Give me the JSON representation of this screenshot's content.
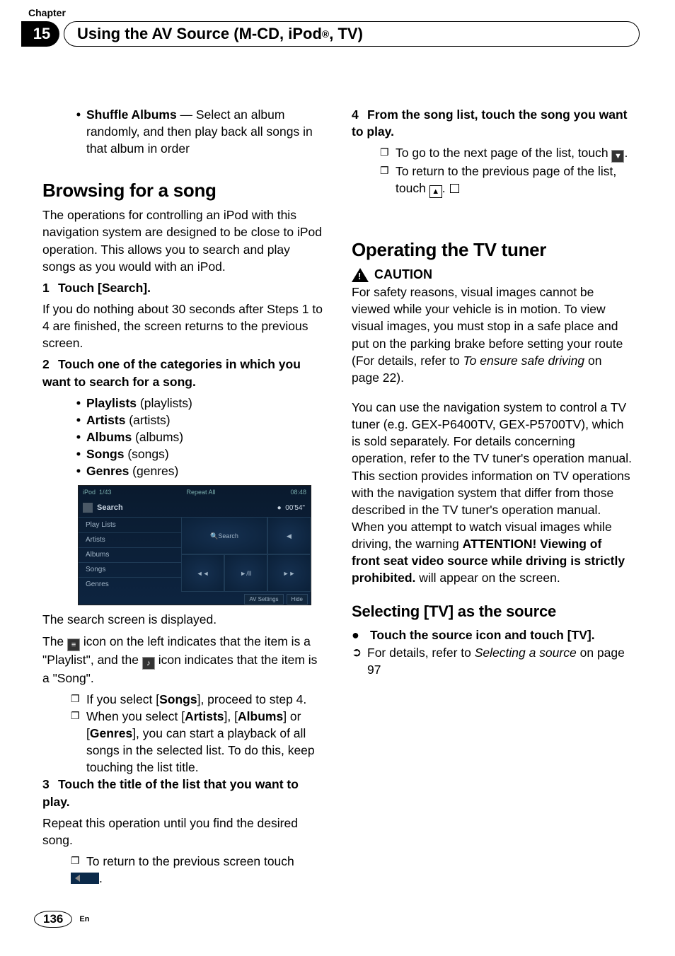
{
  "header": {
    "chapter_label": "Chapter",
    "chapter_number": "15",
    "title_prefix": "Using the AV Source (M-CD, iPod",
    "title_reg": "®",
    "title_suffix": ", TV)"
  },
  "left": {
    "shuffle": {
      "label": "Shuffle Albums",
      "desc": " — Select an album randomly, and then play back all songs in that album in order"
    },
    "h1": "Browsing for a song",
    "intro": "The operations for controlling an iPod with this navigation system are designed to be close to iPod operation. This allows you to search and play songs as you would with an iPod.",
    "step1": {
      "num": "1",
      "title": "Touch [Search].",
      "body": "If you do nothing about 30 seconds after Steps 1 to 4 are finished, the screen returns to the previous screen."
    },
    "step2": {
      "num": "2",
      "title": "Touch one of the categories in which you want to search for a song.",
      "items": [
        {
          "b": "Playlists",
          "p": " (playlists)"
        },
        {
          "b": "Artists",
          "p": " (artists)"
        },
        {
          "b": "Albums",
          "p": " (albums)"
        },
        {
          "b": "Songs",
          "p": " (songs)"
        },
        {
          "b": "Genres",
          "p": " (genres)"
        }
      ]
    },
    "screenshot": {
      "top_left": "iPod",
      "top_mid": "1/43",
      "top_center": "Repeat All",
      "top_right": "08:48",
      "title": "Search",
      "rows": [
        "Play Lists",
        "Artists",
        "Albums",
        "Songs",
        "Genres"
      ],
      "time": "00'54\"",
      "right_cells": [
        "Search",
        "◄◄",
        "►/II",
        "►►",
        "↺",
        "✕"
      ],
      "btn1": "AV Settings",
      "btn2": "Hide"
    },
    "after_ss_1": "The search screen is displayed.",
    "after_ss_2a": "The ",
    "after_ss_2b": " icon on the left indicates that the item is a \"Playlist\", and the ",
    "after_ss_2c": " icon indicates that the item is a \"Song\".",
    "sq1a": "If you select [",
    "sq1b": "Songs",
    "sq1c": "], proceed to step 4.",
    "sq2a": "When you select [",
    "sq2b": "Artists",
    "sq2c": "], [",
    "sq2d": "Albums",
    "sq2e": "] or [",
    "sq2f": "Genres",
    "sq2g": "], you can start a playback of all songs in the selected list. To do this, keep touching the list title.",
    "step3": {
      "num": "3",
      "title": "Touch the title of the list that you want to play.",
      "body": "Repeat this operation until you find the desired song.",
      "sq": "To return to the previous screen touch"
    }
  },
  "right": {
    "step4": {
      "num": "4",
      "title": "From the song list, touch the song you want to play.",
      "sq1": "To go to the next page of the list, touch ",
      "sq2": "To return to the previous page of the list, touch "
    },
    "h1": "Operating the TV tuner",
    "caution_label": "CAUTION",
    "caution_body_a": "For safety reasons, visual images cannot be viewed while your vehicle is in motion. To view visual images, you must stop in a safe place and put on the parking brake before setting your route (For details, refer to ",
    "caution_body_i": "To ensure safe driving",
    "caution_body_b": " on page 22).",
    "para2_a": "You can use the navigation system to control a TV tuner (e.g. GEX-P6400TV, GEX-P5700TV), which is sold separately. For details concerning operation, refer to the TV tuner's operation manual. This section provides information on TV operations with the navigation system that differ from those described in the TV tuner's operation manual. When you attempt to watch visual images while driving, the warning ",
    "para2_b": "ATTENTION! Viewing of front seat video source while driving is strictly prohibited.",
    "para2_c": " will appear on the screen.",
    "h2": "Selecting [TV] as the source",
    "tv_bullet": "Touch the source icon and touch [TV].",
    "tv_ref_a": " For details, refer to ",
    "tv_ref_i": "Selecting a source",
    "tv_ref_b": " on page 97"
  },
  "footer": {
    "page": "136",
    "lang": "En"
  }
}
